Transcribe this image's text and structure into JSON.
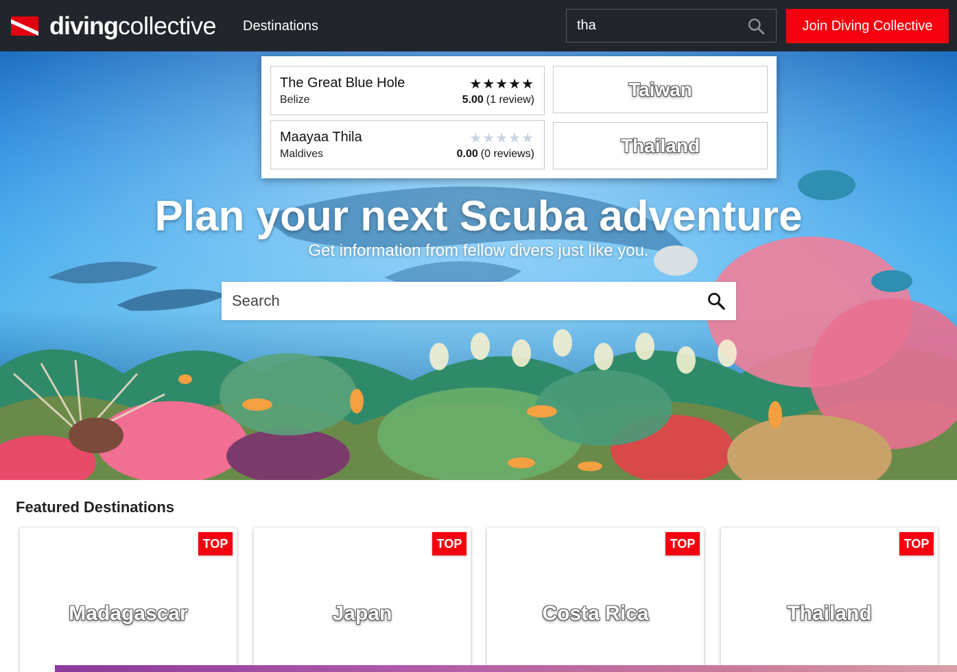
{
  "navbar": {
    "brand_bold": "diving",
    "brand_light": "collective",
    "destinations_link": "Destinations",
    "search_value": "tha",
    "join_button": "Join Diving Collective",
    "accent_color": "#f5000f"
  },
  "search_dropdown": {
    "results": [
      {
        "name": "The Great Blue Hole",
        "country": "Belize",
        "rating": "5.00",
        "reviews": "(1 review)",
        "stars_filled": 5
      },
      {
        "name": "Maayaa Thila",
        "country": "Maldives",
        "rating": "0.00",
        "reviews": "(0 reviews)",
        "stars_filled": 0
      }
    ],
    "countries": [
      "Taiwan",
      "Thailand"
    ]
  },
  "hero": {
    "title": "Plan your next Scuba adventure",
    "subtitle": "Get information from fellow divers just like you.",
    "search_placeholder": "Search"
  },
  "featured": {
    "heading": "Featured Destinations",
    "badge": "TOP",
    "cards": [
      "Madagascar",
      "Japan",
      "Costa Rica",
      "Thailand"
    ]
  }
}
